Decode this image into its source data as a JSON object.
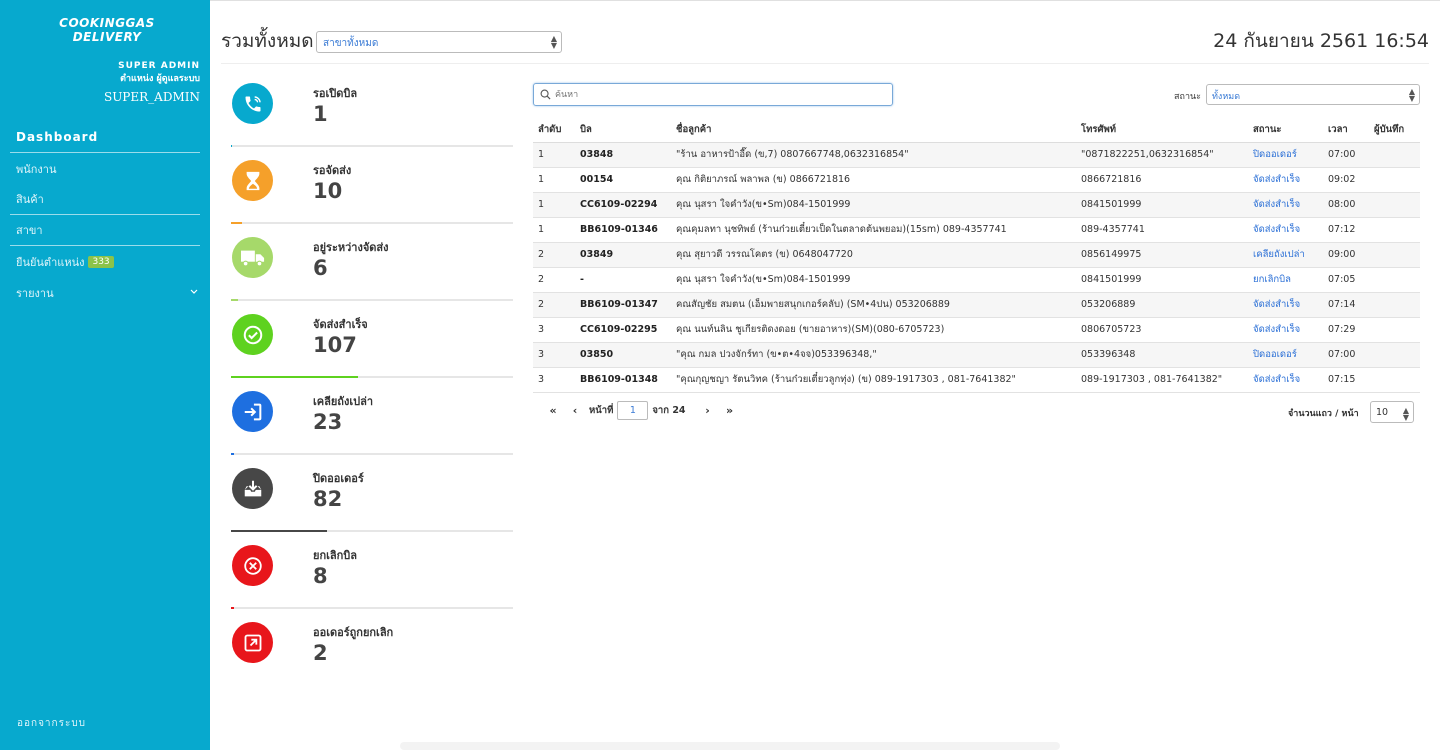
{
  "sidebar": {
    "logo_line1": "COOKINGGAS",
    "logo_line2": "DELIVERY",
    "user_role": "SUPER ADMIN",
    "user_position": "ตำแหน่ง ผู้ดูแลระบบ",
    "user_name": "SUPER_ADMIN",
    "items": [
      {
        "label": "Dashboard"
      },
      {
        "label": "พนักงาน"
      },
      {
        "label": "สินค้า"
      },
      {
        "label": "สาขา"
      },
      {
        "label": "ยืนยันตำแหน่ง",
        "badge": "333"
      },
      {
        "label": "รายงาน"
      }
    ],
    "logout": "ออกจากระบบ"
  },
  "header": {
    "title": "รวมทั้งหมด",
    "branch_select": "สาขาทั้งหมด",
    "datetime": "24 กันยายน 2561 16:54"
  },
  "stats": [
    {
      "label": "รอเปิดบิล",
      "value": "1",
      "color": "#07a9ce",
      "icon": "phone-icon",
      "progress": 0.0
    },
    {
      "label": "รอจัดส่ง",
      "value": "10",
      "color": "#f5a02a",
      "icon": "hourglass-icon",
      "progress": 0.04
    },
    {
      "label": "อยู่ระหว่างจัดส่ง",
      "value": "6",
      "color": "#a6d96a",
      "icon": "truck-icon",
      "progress": 0.025
    },
    {
      "label": "จัดส่งสำเร็จ",
      "value": "107",
      "color": "#5ed21f",
      "icon": "check-circle-icon",
      "progress": 0.45
    },
    {
      "label": "เคลียถังเปล่า",
      "value": "23",
      "color": "#1e6fe0",
      "icon": "sign-in-icon",
      "progress": 0.01
    },
    {
      "label": "ปิดออเดอร์",
      "value": "82",
      "color": "#474747",
      "icon": "inbox-download-icon",
      "progress": 0.34
    },
    {
      "label": "ยกเลิกบิล",
      "value": "8",
      "color": "#e8161b",
      "icon": "cancel-circle-icon",
      "progress": 0.01
    },
    {
      "label": "ออเดอร์ถูกยกเลิก",
      "value": "2",
      "color": "#e8161b",
      "icon": "external-link-icon",
      "progress": 0.0
    }
  ],
  "search": {
    "placeholder": "ค้นหา"
  },
  "status_filter": {
    "label": "สถานะ",
    "value": "ทั้งหมด"
  },
  "table": {
    "headers": [
      "ลำดับ",
      "บิล",
      "ชื่อลูกค้า",
      "โทรศัพท์",
      "สถานะ",
      "เวลา",
      "ผู้บันทึก"
    ],
    "rows": [
      [
        "1",
        "03848",
        "\"ร้าน อาหารป้าอี๊ด (ข,7) 0807667748,0632316854\"",
        "\"0871822251,0632316854\"",
        "ปิดออเดอร์",
        "07:00",
        ""
      ],
      [
        "1",
        "00154",
        "คุณ กิติยาภรณ์ พลาพล (ข) 0866721816",
        "0866721816",
        "จัดส่งสำเร็จ",
        "09:02",
        ""
      ],
      [
        "1",
        "CC6109-02294",
        "คุณ นุสรา ใจคำวัง(ข•Sm)084-1501999",
        "0841501999",
        "จัดส่งสำเร็จ",
        "08:00",
        ""
      ],
      [
        "1",
        "BB6109-01346",
        "คุณคุมลทา นุชทิพย์ (ร้านก๋วยเตี๋ยวเป็ดในตลาดต้นพยอม)(15sm) 089-4357741",
        "089-4357741",
        "จัดส่งสำเร็จ",
        "07:12",
        ""
      ],
      [
        "2",
        "03849",
        "คุณ สุยาวดี วรรณโคตร (ข) 0648047720",
        "0856149975",
        "เคลียถังเปล่า",
        "09:00",
        ""
      ],
      [
        "2",
        "-",
        "คุณ นุสรา ใจคำวัง(ข•Sm)084-1501999",
        "0841501999",
        "ยกเลิกบิล",
        "07:05",
        ""
      ],
      [
        "2",
        "BB6109-01347",
        "คณสัญชัย สมตน (เอ็มพายสนุกเกอร์คลับ) (SM•4ปน) 053206889",
        "053206889",
        "จัดส่งสำเร็จ",
        "07:14",
        ""
      ],
      [
        "3",
        "CC6109-02295",
        "คุณ นนท์นลิน ชูเกียรติดงดอย (ขายอาหาร)(SM)(080-6705723)",
        "0806705723",
        "จัดส่งสำเร็จ",
        "07:29",
        ""
      ],
      [
        "3",
        "03850",
        "\"คุณ กมล ปวงจักร์ทา (ข•ต•4จจ)053396348,\"",
        "053396348",
        "ปิดออเดอร์",
        "07:00",
        ""
      ],
      [
        "3",
        "BB6109-01348",
        "\"คุณกุญชญา รัตนวิทค (ร้านก๋วยเตี๋ยวลูกทุ่ง) (ข) 089-1917303 , 081-7641382\"",
        "089-1917303 , 081-7641382\"",
        "จัดส่งสำเร็จ",
        "07:15",
        ""
      ]
    ]
  },
  "pagination": {
    "page_label": "หน้าที่",
    "current_page": "1",
    "of_label": "จาก 24",
    "rows_per_page_label": "จำนวนแถว / หน้า",
    "rows_per_page": "10"
  }
}
